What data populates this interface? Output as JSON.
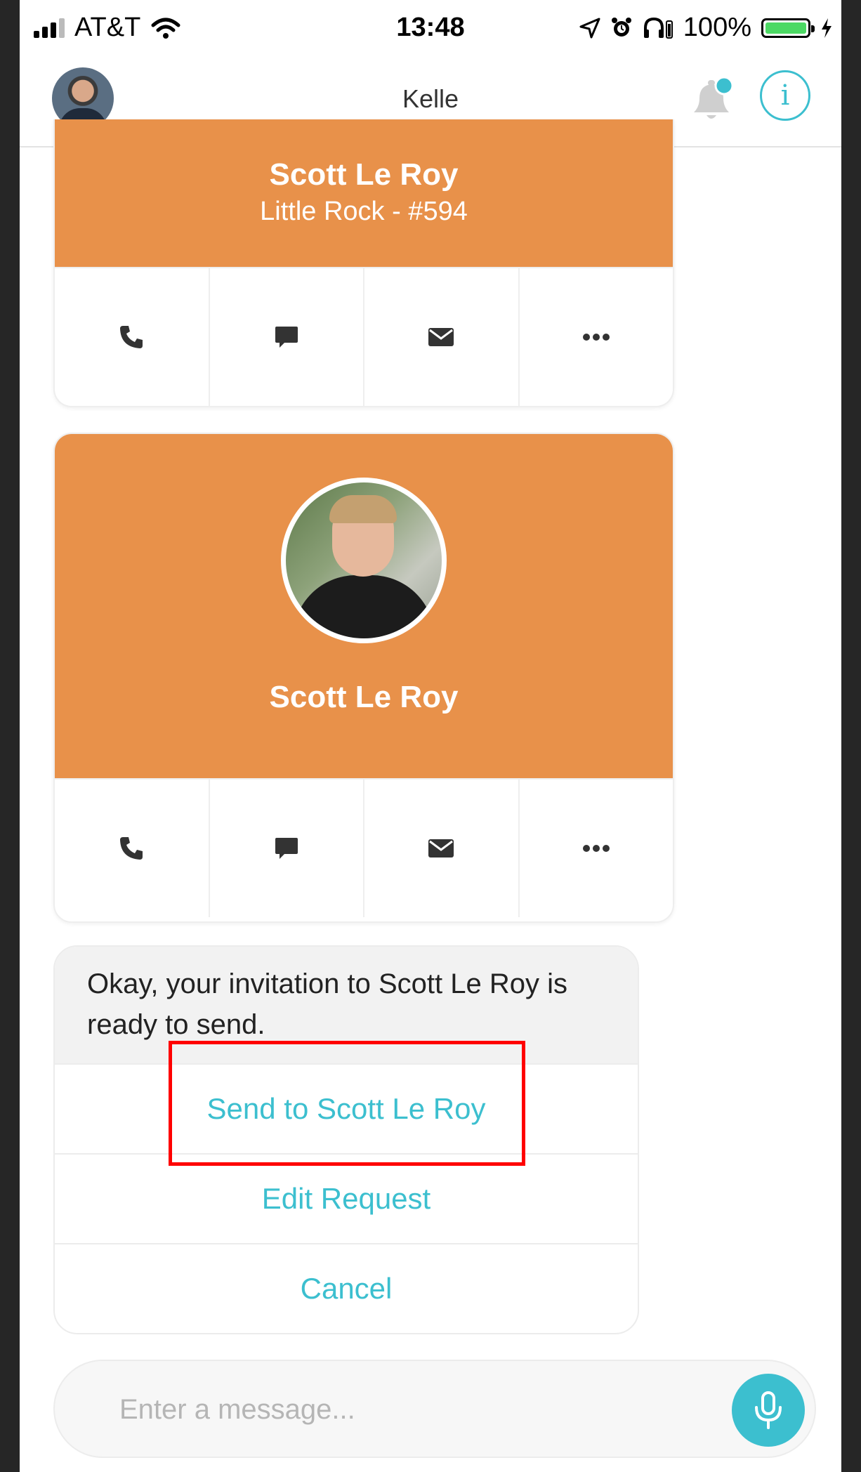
{
  "status_bar": {
    "carrier": "AT&T",
    "time": "13:48",
    "battery_percent": "100%",
    "battery_level": 1.0
  },
  "nav": {
    "title": "Kelle"
  },
  "cards": [
    {
      "name": "Scott Le Roy",
      "subtitle": "Little Rock - #594",
      "actions": [
        "phone-icon",
        "chat-icon",
        "mail-icon",
        "more-icon"
      ]
    },
    {
      "name": "Scott Le Roy",
      "actions": [
        "phone-icon",
        "chat-icon",
        "mail-icon",
        "more-icon"
      ]
    }
  ],
  "bubble": {
    "text": "Okay, your invitation to Scott Le Roy is ready to send.",
    "options": [
      "Send to Scott Le Roy",
      "Edit Request",
      "Cancel"
    ]
  },
  "composer": {
    "placeholder": "Enter a message..."
  },
  "colors": {
    "accent": "#3cbfcf",
    "card_header": "#e8914a",
    "highlight": "#ff0000"
  }
}
